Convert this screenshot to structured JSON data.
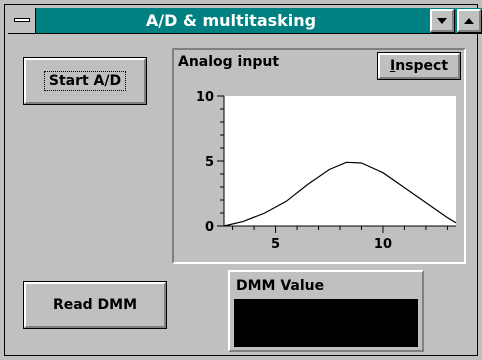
{
  "window": {
    "title": "A/D & multitasking"
  },
  "buttons": {
    "start_ad": "Start A/D",
    "read_dmm": "Read DMM",
    "inspect_prefix": "I",
    "inspect_rest": "nspect"
  },
  "chart_panel": {
    "title": "Analog input"
  },
  "dmm": {
    "label": "DMM Value",
    "value": ""
  },
  "chart_data": {
    "type": "line",
    "title": "Analog input",
    "xlabel": "",
    "ylabel": "",
    "xlim": [
      2.6,
      13.4
    ],
    "ylim": [
      0,
      10
    ],
    "xticks": [
      5,
      10
    ],
    "yticks": [
      0,
      5,
      10
    ],
    "grid": false,
    "series": [
      {
        "x": [
          2.6,
          3.5,
          4.5,
          5.5,
          6.5,
          7.5,
          8.3,
          9.0,
          10.0,
          11.0,
          12.0,
          13.0,
          13.4
        ],
        "values": [
          0.0,
          0.35,
          1.0,
          1.9,
          3.2,
          4.35,
          4.9,
          4.85,
          4.1,
          2.95,
          1.8,
          0.65,
          0.25
        ]
      }
    ],
    "colors": {
      "plot_bg": "#ffffff",
      "line": "#000000"
    }
  }
}
